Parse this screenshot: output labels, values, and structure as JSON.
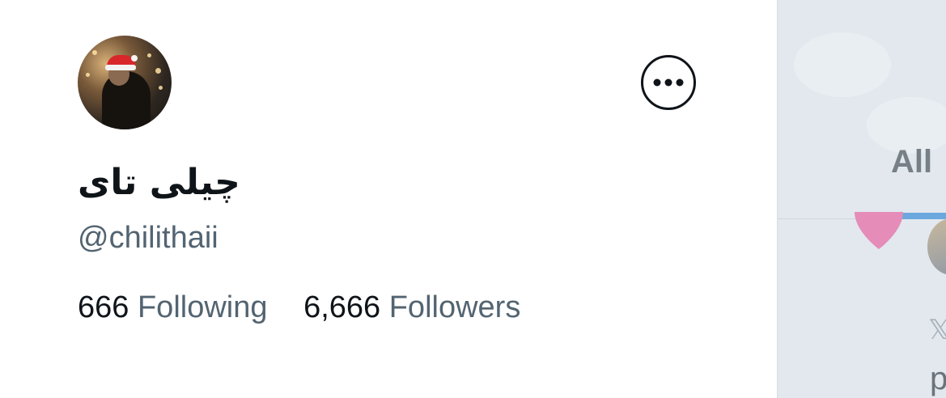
{
  "profile": {
    "display_name": "چیلی تای",
    "handle": "@chilithaii",
    "following_count": "666",
    "following_label": "Following",
    "followers_count": "6,666",
    "followers_label": "Followers",
    "avatar_icon": "profile-photo"
  },
  "actions": {
    "more_icon": "more-horizontal-icon"
  },
  "side_panel": {
    "tab_all_label": "All",
    "x_glyph": "𝕏",
    "p_glyph": "p"
  },
  "colors": {
    "text_primary": "#0f1419",
    "text_secondary": "#536471",
    "tab_indicator": "#6ca8de",
    "heart": "#e58cb8"
  }
}
